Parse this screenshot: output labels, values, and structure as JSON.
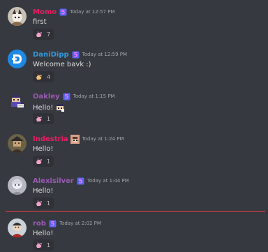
{
  "messages": [
    {
      "username": "Momo",
      "color": "#e91e63",
      "badge_icon": "nitro-badge-icon",
      "timestamp": "Today at 12:57 PM",
      "text": "first",
      "reaction_emoji": "pony-emoji",
      "reaction_count": "7"
    },
    {
      "username": "DaniDipp",
      "color": "#3498db",
      "badge_icon": "nitro-badge-icon",
      "timestamp": "Today at 12:59 PM",
      "text": "Welcome bavk :)",
      "reaction_emoji": "pony-emoji",
      "reaction_count": "4"
    },
    {
      "username": "Oakley",
      "color": "#9b59b6",
      "badge_icon": "nitro-badge-icon",
      "timestamp": "Today at 1:15 PM",
      "text": "Hello!",
      "inline_emoji": "pixel-face-emoji",
      "reaction_emoji": "pony-emoji",
      "reaction_count": "1"
    },
    {
      "username": "Indestria",
      "color": "#e91e63",
      "badge_icon": "pixel-art-badge-icon",
      "timestamp": "Today at 1:24 PM",
      "text": "Hello!",
      "reaction_emoji": "pony-emoji",
      "reaction_count": "1"
    },
    {
      "username": "Alexisilver",
      "color": "#9b59b6",
      "badge_icon": "nitro-badge-icon",
      "timestamp": "Today at 1:44 PM",
      "text": "Hello!",
      "reaction_emoji": "pony-emoji",
      "reaction_count": "1"
    },
    {
      "username": "rob",
      "color": "#9b59b6",
      "badge_icon": "nitro-badge-icon",
      "timestamp": "Today at 2:02 PM",
      "text": "Hello!",
      "reaction_emoji": "pony-emoji",
      "reaction_count": "1"
    }
  ],
  "colors": {
    "background": "#36393f",
    "reaction_bg": "#2f3136",
    "badge": "#8e44ad",
    "new_messages_divider": "#ed4245"
  }
}
